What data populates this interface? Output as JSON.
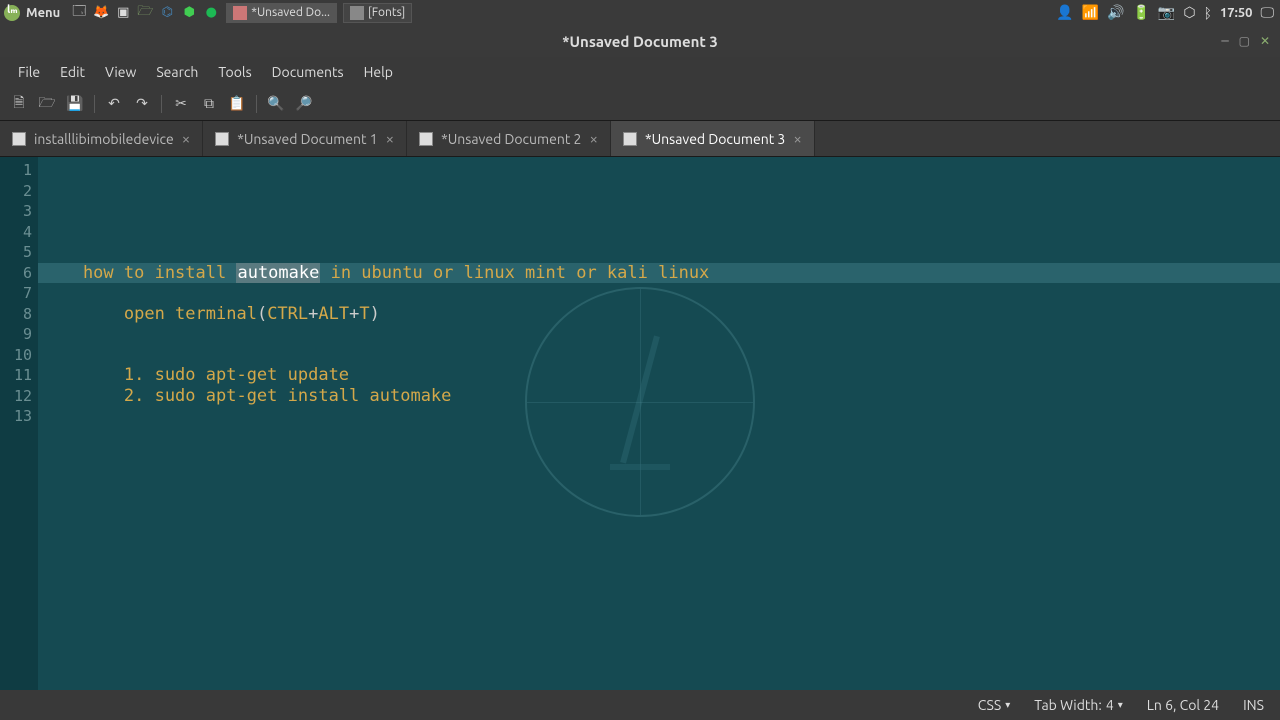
{
  "panel": {
    "menu_label": "Menu",
    "tasks": [
      {
        "label": "*Unsaved Do...",
        "icon": "gedit"
      },
      {
        "label": "[Fonts]",
        "icon": "fonts"
      }
    ],
    "clock": "17:50"
  },
  "window": {
    "title": "*Unsaved Document 3"
  },
  "menubar": [
    "File",
    "Edit",
    "View",
    "Search",
    "Tools",
    "Documents",
    "Help"
  ],
  "tabs": [
    {
      "label": "installlibimobiledevice",
      "active": false
    },
    {
      "label": "*Unsaved Document 1",
      "active": false
    },
    {
      "label": "*Unsaved Document 2",
      "active": false
    },
    {
      "label": "*Unsaved Document 3",
      "active": true
    }
  ],
  "editor": {
    "highlighted_line": 6,
    "selected_word": "automake",
    "lines": [
      "",
      "",
      "",
      "",
      "",
      "    how to install automake in ubuntu or linux mint or kali linux",
      "",
      "        open terminal(CTRL+ALT+T)",
      "",
      "",
      "        1. sudo apt-get update",
      "        2. sudo apt-get install automake",
      ""
    ]
  },
  "statusbar": {
    "syntax": "CSS",
    "tab_width_label": "Tab Width:",
    "tab_width_value": "4",
    "cursor": "Ln 6, Col 24",
    "mode": "INS"
  }
}
